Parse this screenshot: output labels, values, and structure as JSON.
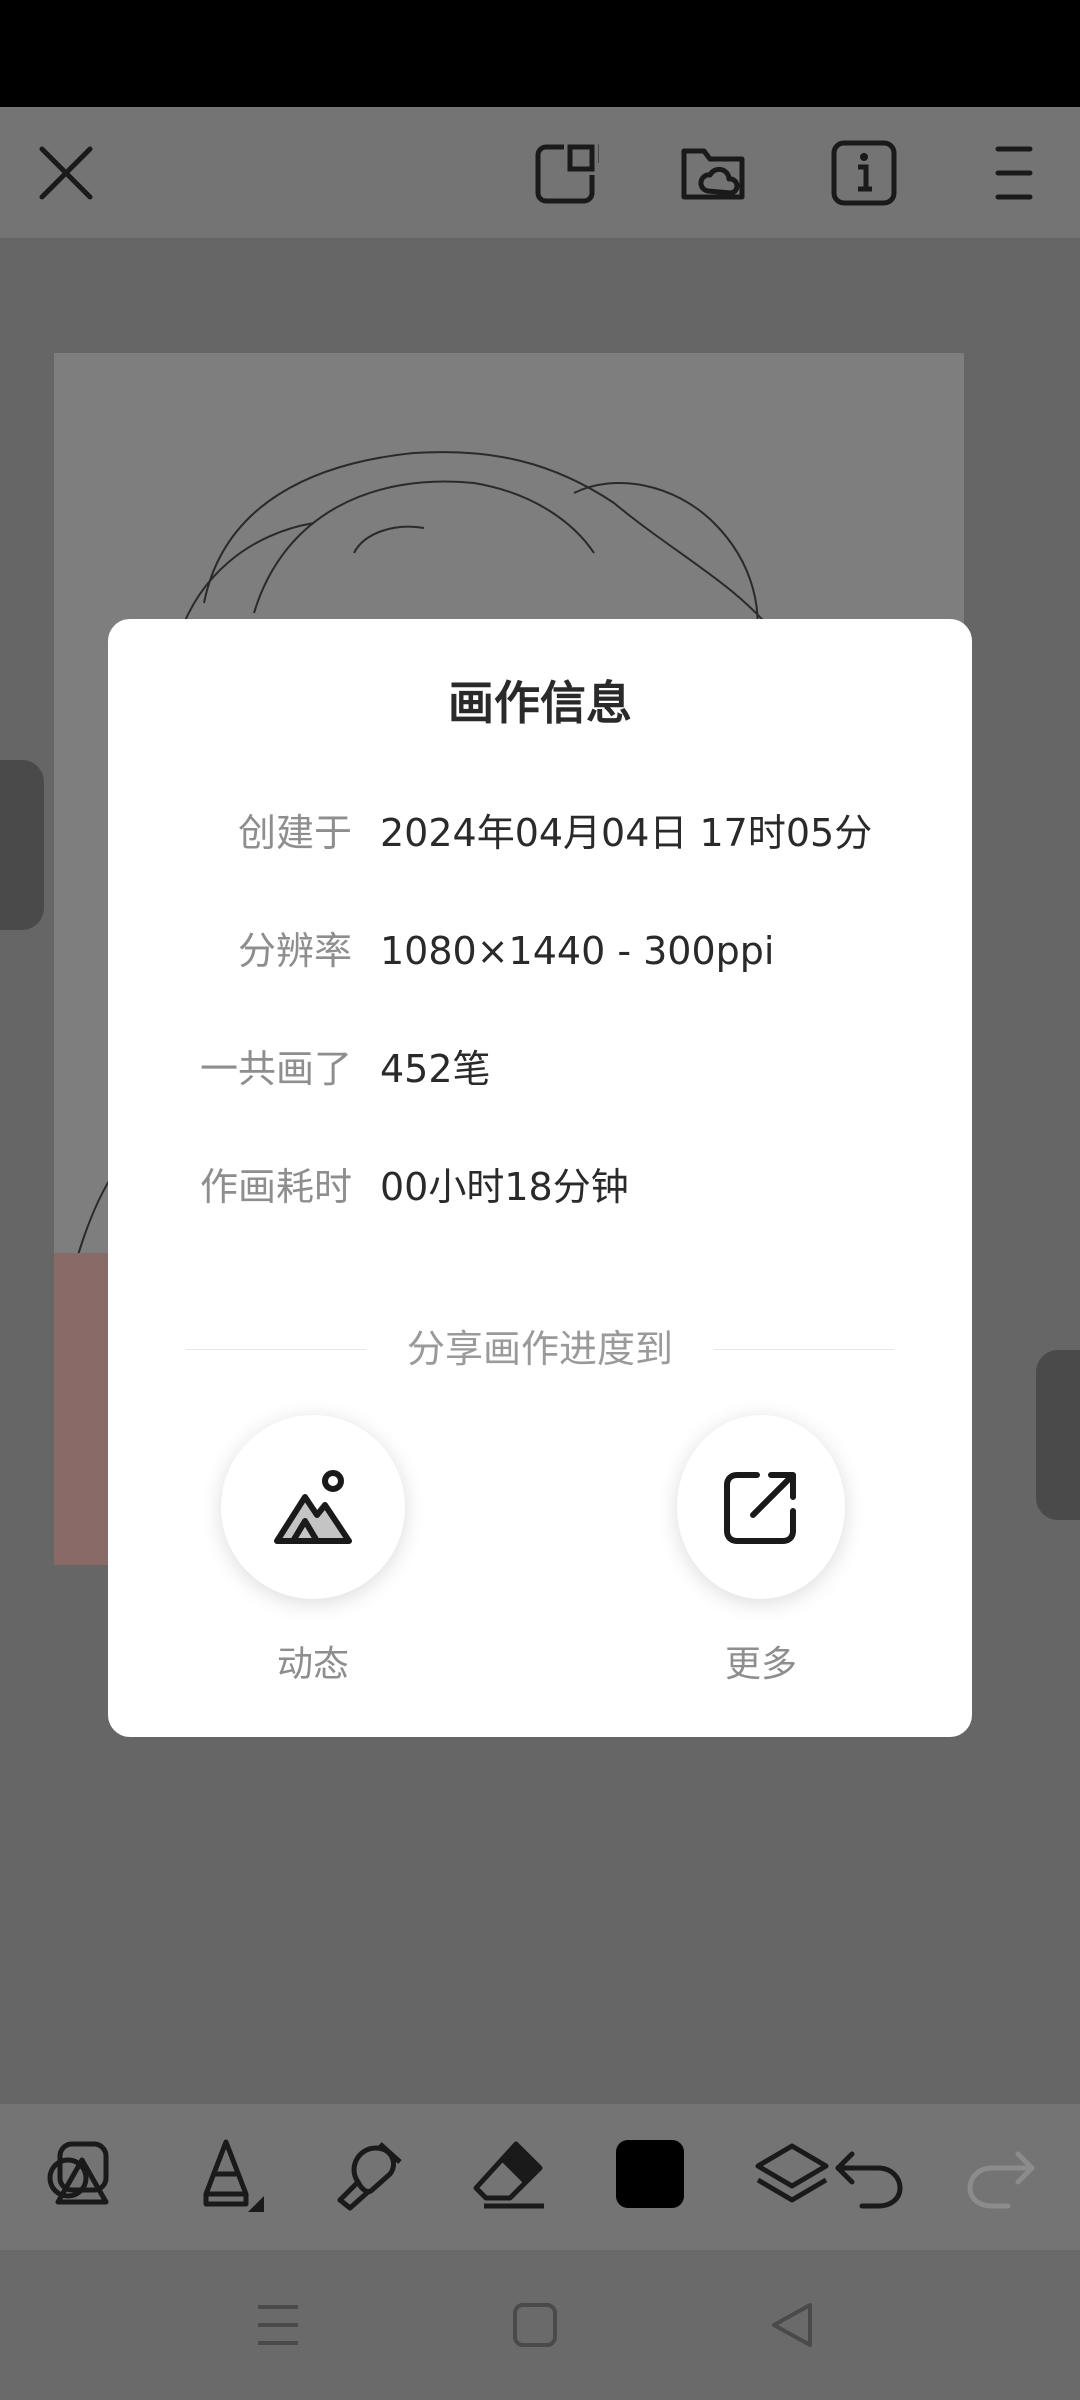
{
  "dialog": {
    "title": "画作信息",
    "rows": [
      {
        "label": "创建于",
        "value": "2024年04月04日 17时05分"
      },
      {
        "label": "分辨率",
        "value": "1080×1440 - 300ppi"
      },
      {
        "label": "一共画了",
        "value": "452笔"
      },
      {
        "label": "作画耗时",
        "value": "00小时18分钟"
      }
    ],
    "share_heading": "分享画作进度到",
    "share_targets": [
      {
        "label": "动态",
        "icon": "mountain-image-icon"
      },
      {
        "label": "更多",
        "icon": "external-share-icon"
      }
    ]
  },
  "top_toolbar": {
    "icons": [
      "close-icon",
      "export-icon",
      "cloud-folder-icon",
      "info-icon",
      "menu-icon"
    ]
  },
  "bottom_toolbar": {
    "icons": [
      "shapes-icon",
      "pencil-icon",
      "smudge-icon",
      "eraser-icon",
      "color-swatch-icon",
      "layers-icon",
      "undo-icon",
      "redo-icon"
    ],
    "color_swatch": "#000000"
  },
  "colors": {
    "dialog_bg": "#ffffff",
    "scrim": "#6a6a6a",
    "label_gray": "#8e8e8e",
    "text_dark": "#2a2a2a"
  }
}
